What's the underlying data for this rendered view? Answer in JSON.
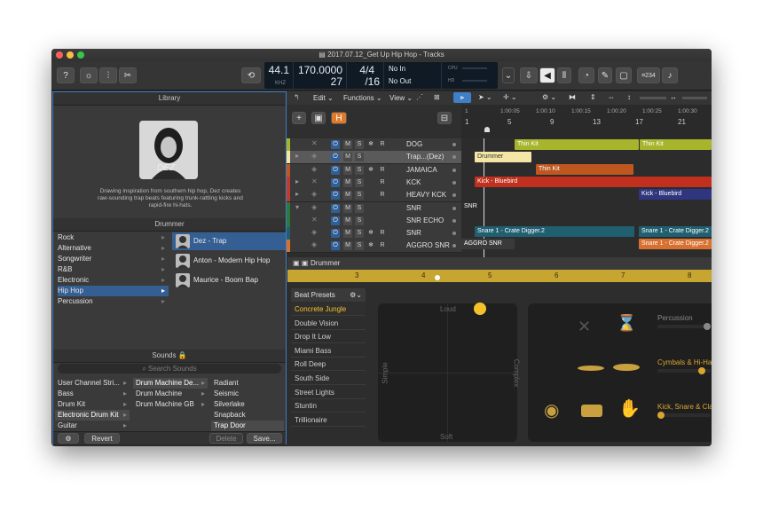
{
  "window": {
    "title": "2017.07.12_Get Up Hip Hop - Tracks"
  },
  "lcd": {
    "tempo_top": "44.1",
    "tempo_sub": "KHZ",
    "bpm": "170.0000",
    "bpm2": "27",
    "sig_top": "4/4",
    "sig_bottom": "/16",
    "in": "No In",
    "out": "No Out",
    "cpu": "CPU",
    "hd": "HD",
    "counter": "¤234"
  },
  "library": {
    "header": "Library",
    "drummer_name": "DEZ",
    "description": "Drawing inspiration from southern hip hop, Dez creates raw-sounding trap beats featuring trunk-rattling kicks and rapid-fire hi-hats.",
    "drummer_header": "Drummer",
    "genres": [
      "Rock",
      "Alternative",
      "Songwriter",
      "R&B",
      "Electronic",
      "Hip Hop",
      "Percussion"
    ],
    "selected_genre": "Hip Hop",
    "drummers": [
      "Dez - Trap",
      "Anton - Modern Hip Hop",
      "Maurice - Boom Bap"
    ],
    "sounds_header": "Sounds 🔒",
    "search_placeholder": "Search Sounds",
    "sound_col1": [
      "User Channel Stri...",
      "Bass",
      "Drum Kit",
      "Electronic Drum Kit",
      "Guitar"
    ],
    "sound_col2": [
      "Drum Machine De...",
      "Drum Machine",
      "Drum Machine GB"
    ],
    "sound_col3": [
      "Radiant",
      "Seismic",
      "Silverlake",
      "Snapback",
      "Trap Door"
    ],
    "revert": "Revert",
    "delete": "Delete",
    "save": "Save..."
  },
  "tracks_toolbar": {
    "edit": "Edit",
    "functions": "Functions",
    "view": "View"
  },
  "ruler": {
    "bars": [
      "1",
      "5",
      "9",
      "13",
      "17",
      "21"
    ],
    "times": [
      "1",
      "1:00:05",
      "1:00:10",
      "1:00:15",
      "1:00:20",
      "1:00:25",
      "1:00:30"
    ]
  },
  "tracks": [
    {
      "name": "DOG"
    },
    {
      "name": "Trap...(Dez)"
    },
    {
      "name": "JAMAICA"
    },
    {
      "name": "KCK"
    },
    {
      "name": "HEAVY KCK"
    },
    {
      "name": "SNR"
    },
    {
      "name": "SNR ECHO"
    },
    {
      "name": "SNR"
    },
    {
      "name": "AGGRO SNR"
    }
  ],
  "regions": {
    "thin_kit_1": "Thin Kit",
    "thin_kit_2": "Thin Kit",
    "drummer": "Drummer",
    "thin_kit_3": "Thin Kit",
    "kick_bluebird_1": "Kick - Bluebird",
    "kick_bluebird_2": "Kick - Bluebird",
    "snr_label": "SNR",
    "snare_1": "Snare 1 - Crate Digger.2",
    "snare_2": "Snare 1 - Crate Digger.2",
    "aggro_1": "AGGRO SNR",
    "snare_3": "Snare 1 - Crate Digger.2"
  },
  "editor": {
    "header": "Drummer",
    "bars": [
      "3",
      "4",
      "5",
      "6",
      "7",
      "8"
    ],
    "beat_presets": "Beat Presets",
    "presets": [
      "Concrete Jungle",
      "Double Vision",
      "Drop It Low",
      "Miami Bass",
      "Roll Deep",
      "South Side",
      "Street Lights",
      "Stuntin",
      "Trillionaire"
    ],
    "selected_preset": "Concrete Jungle",
    "pad_loud": "Loud",
    "pad_soft": "Soft",
    "pad_simple": "Simple",
    "pad_complex": "Complex",
    "percussion": "Percussion",
    "cymbals": "Cymbals & Hi-Hats",
    "kick_snare": "Kick, Snare & Clap"
  },
  "colors": {
    "accent": "#f5c12a",
    "selection": "#3f7fc6",
    "lime": "#a6b52a",
    "red": "#c13a2a"
  }
}
